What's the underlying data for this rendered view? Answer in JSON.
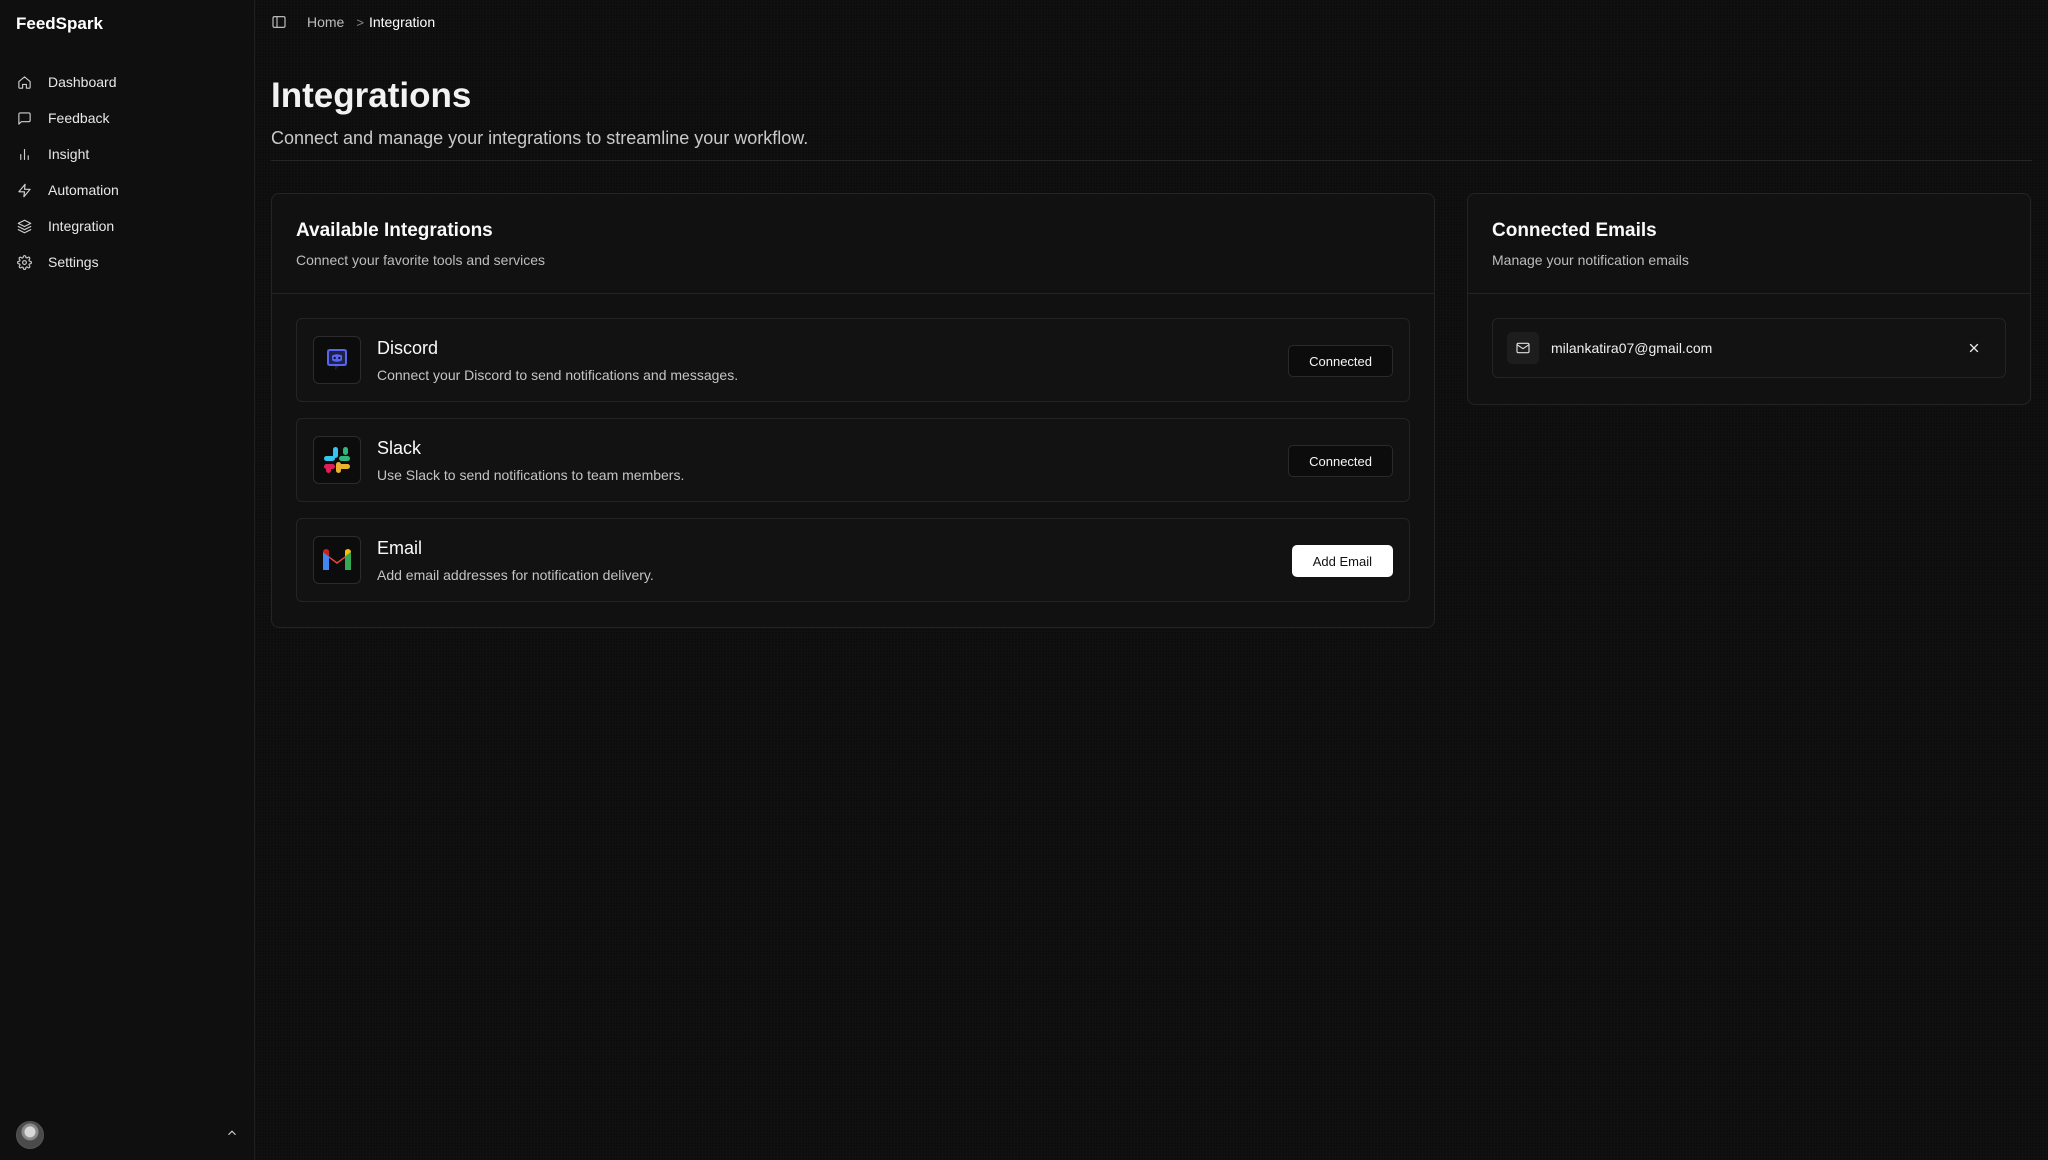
{
  "app": {
    "name": "FeedSpark"
  },
  "sidebar": {
    "items": [
      {
        "label": "Dashboard",
        "icon": "home-icon"
      },
      {
        "label": "Feedback",
        "icon": "message-square-icon"
      },
      {
        "label": "Insight",
        "icon": "bar-chart-icon"
      },
      {
        "label": "Automation",
        "icon": "zap-icon"
      },
      {
        "label": "Integration",
        "icon": "layers-icon"
      },
      {
        "label": "Settings",
        "icon": "gear-icon"
      }
    ]
  },
  "breadcrumb": {
    "home": "Home",
    "separator": ">",
    "current": "Integration"
  },
  "page": {
    "title": "Integrations",
    "subtitle": "Connect and manage your integrations to streamline your workflow."
  },
  "integrations": {
    "title": "Available Integrations",
    "description": "Connect your favorite tools and services",
    "items": [
      {
        "name": "Discord",
        "description": "Connect your Discord to send notifications and messages.",
        "action": "Connected",
        "logo": "discord-logo"
      },
      {
        "name": "Slack",
        "description": "Use Slack to send notifications to team members.",
        "action": "Connected",
        "logo": "slack-logo"
      },
      {
        "name": "Email",
        "description": "Add email addresses for notification delivery.",
        "action": "Add Email",
        "logo": "gmail-logo"
      }
    ]
  },
  "emails": {
    "title": "Connected Emails",
    "description": "Manage your notification emails",
    "items": [
      {
        "address": "milankatira07@gmail.com"
      }
    ]
  },
  "colors": {
    "background": "#0d0d0d",
    "discord": "#5865F2",
    "slack_blue": "#36C5F0",
    "slack_green": "#2EB67D",
    "slack_red": "#E01E5A",
    "slack_yellow": "#ECB22E"
  }
}
